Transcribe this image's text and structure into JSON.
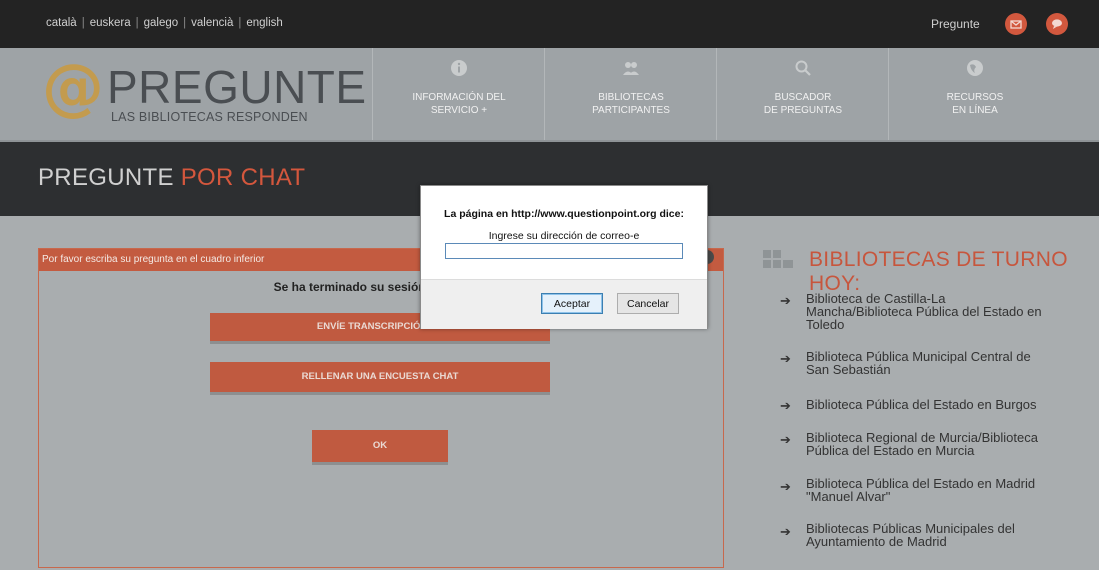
{
  "topbar": {
    "languages": [
      "català",
      "euskera",
      "galego",
      "valencià",
      "english"
    ],
    "pregunte_label": "Pregunte",
    "mail_icon": "mail-icon",
    "chat_icon": "chat-icon"
  },
  "header": {
    "logo_symbol": "@",
    "logo_title": "PREGUNTE",
    "logo_subtitle": "LAS BIBLIOTECAS RESPONDEN",
    "nav": [
      {
        "line1": "INFORMACIÓN DEL",
        "line2": "SERVICIO +",
        "icon": "info-icon"
      },
      {
        "line1": "BIBLIOTECAS",
        "line2": "PARTICIPANTES",
        "icon": "people-icon"
      },
      {
        "line1": "BUSCADOR",
        "line2": "DE PREGUNTAS",
        "icon": "search-icon"
      },
      {
        "line1": "RECURSOS",
        "line2": "EN LÍNEA",
        "icon": "globe-icon"
      }
    ]
  },
  "page_title": {
    "part1": "PREGUNTE ",
    "part2": "POR CHAT"
  },
  "panel": {
    "header": "Por favor escriba su pregunta en el cuadro inferior",
    "session_message": "Se ha terminado su sesión. Escoja de",
    "btn_transcript": "ENVÍE TRANSCRIPCIÓN DE",
    "btn_survey": "RELLENAR UNA ENCUESTA CHAT",
    "btn_ok": "OK"
  },
  "sidebar": {
    "title": "BIBLIOTECAS DE TURNO HOY:",
    "libraries": [
      {
        "line1": "Biblioteca de Castilla-La",
        "line2": "Mancha/Biblioteca Pública del Estado en",
        "line3": "Toledo"
      },
      {
        "line1": "Biblioteca Pública Municipal Central de",
        "line2": "San Sebastián",
        "line3": ""
      },
      {
        "line1": "Biblioteca Pública del Estado en Burgos",
        "line2": "",
        "line3": ""
      },
      {
        "line1": "Biblioteca Regional de Murcia/Biblioteca",
        "line2": "Pública del Estado en Murcia",
        "line3": ""
      },
      {
        "line1": "Biblioteca Pública del Estado en Madrid",
        "line2": "\"Manuel Alvar\"",
        "line3": ""
      },
      {
        "line1": "Bibliotecas Públicas Municipales del",
        "line2": "Ayuntamiento de Madrid",
        "line3": ""
      }
    ],
    "arrow": "➔"
  },
  "dialog": {
    "title": "La página en http://www.questionpoint.org dice:",
    "prompt": "Ingrese su dirección de correo-e",
    "input_value": "",
    "accept_label": "Aceptar",
    "cancel_label": "Cancelar"
  },
  "colors": {
    "accent": "#c35b40",
    "dark_band": "#2d2f31",
    "topbar": "#232323"
  }
}
